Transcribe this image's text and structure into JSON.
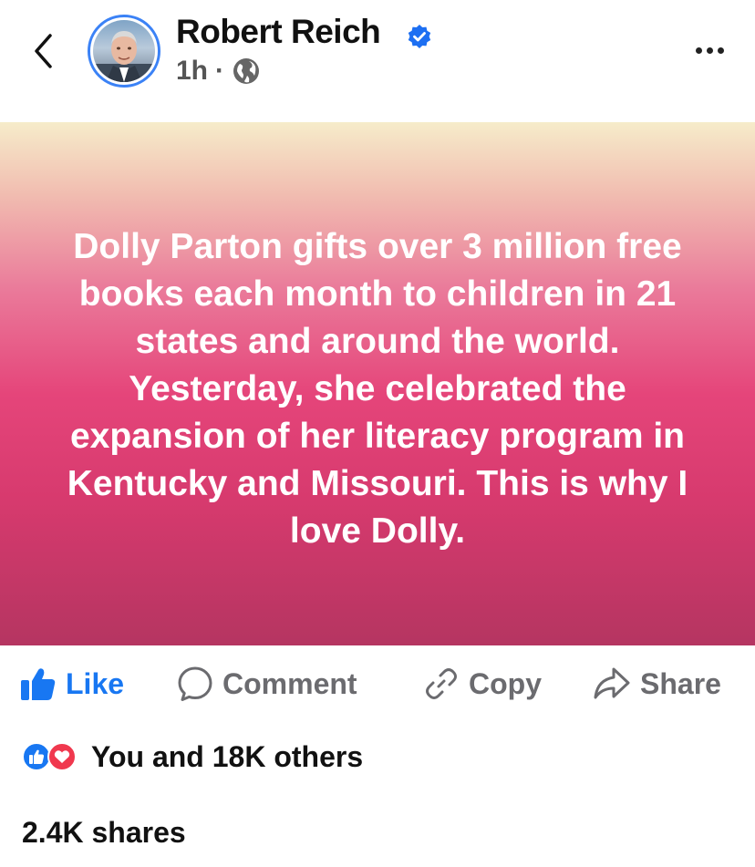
{
  "post": {
    "author": "Robert Reich",
    "time": "1h",
    "separator": "·",
    "text": "Dolly Parton gifts over 3 million free books each month to children in 21 states and around the world. Yesterday, she celebrated the expansion of her literacy program in Kentucky and Missouri. This is why I love Dolly.",
    "background_gradient": [
      "#f6ecca",
      "#ea7a9a",
      "#e5457a",
      "#b53561"
    ]
  },
  "actions": {
    "like_label": "Like",
    "comment_label": "Comment",
    "copy_label": "Copy",
    "share_label": "Share"
  },
  "engagement": {
    "reactions_text": "You and 18K others",
    "shares_text": "2.4K shares"
  },
  "icons": {
    "back": "chevron-left-icon",
    "verified": "verified-badge-icon",
    "privacy": "globe-icon",
    "more": "more-horizontal-icon",
    "like": "thumbs-up-icon",
    "comment": "comment-bubble-icon",
    "copy": "link-icon",
    "share": "share-arrow-icon",
    "reaction_like": "like-reaction-icon",
    "reaction_love": "love-reaction-icon"
  },
  "colors": {
    "accent": "#1877f2",
    "verified": "#1d6ff2",
    "love": "#f0384e",
    "avatar_ring": "#3b82f6",
    "muted": "#6b6b6f"
  }
}
